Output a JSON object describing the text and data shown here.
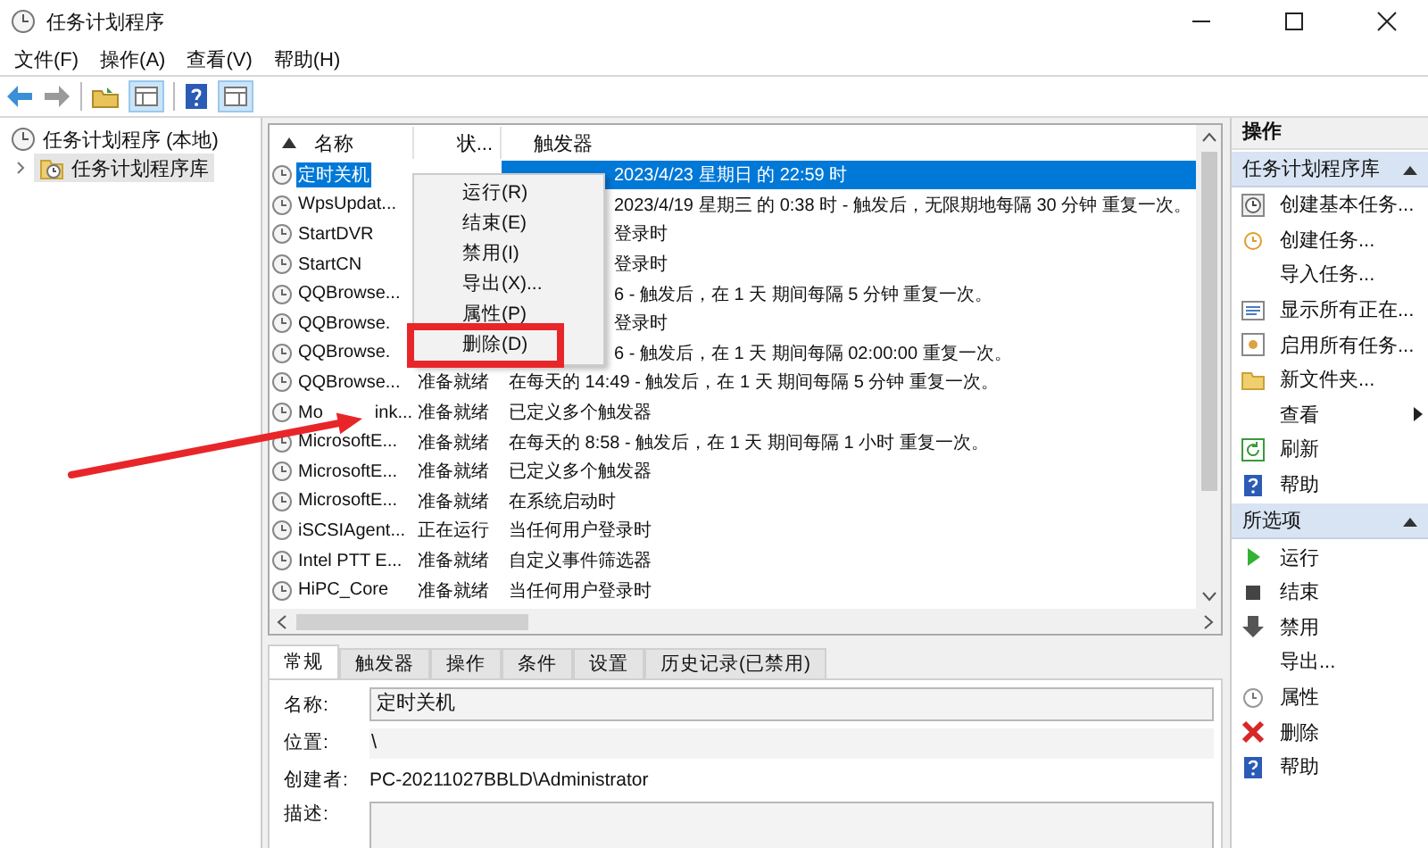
{
  "window": {
    "title": "任务计划程序"
  },
  "menu_bar": [
    "文件(F)",
    "操作(A)",
    "查看(V)",
    "帮助(H)"
  ],
  "tree": [
    {
      "label": "任务计划程序 (本地)",
      "selected": false,
      "children": [
        {
          "label": "任务计划程序库",
          "selected": true,
          "expanded": false
        }
      ]
    }
  ],
  "task_list": {
    "columns": [
      "名称",
      "状...",
      "触发器"
    ],
    "rows": [
      {
        "kind": "covered",
        "name": "定时关机",
        "trigger": "2023/4/23 星期日 的 22:59 时",
        "selected": true
      },
      {
        "kind": "covered",
        "name": "WpsUpdat...",
        "trigger": "2023/4/19 星期三 的 0:38 时 - 触发后，无限期地每隔 30 分钟 重复一次。",
        "selected": false
      },
      {
        "kind": "covered",
        "name": "StartDVR",
        "trigger": "登录时",
        "selected": false
      },
      {
        "kind": "covered",
        "name": "StartCN",
        "trigger": "登录时",
        "selected": false
      },
      {
        "kind": "covered",
        "name": "QQBrowse...",
        "trigger": "6 - 触发后，在 1 天 期间每隔 5 分钟 重复一次。",
        "selected": false
      },
      {
        "kind": "covered",
        "name": "QQBrowse.",
        "trigger": "登录时",
        "selected": false
      },
      {
        "kind": "covered",
        "name": "QQBrowse.",
        "trigger": "6 - 触发后，在 1 天 期间每隔 02:00:00 重复一次。",
        "selected": false
      },
      {
        "kind": "full",
        "name": "QQBrowse...",
        "status": "准备就绪",
        "trigger": "在每天的 14:49 - 触发后，在 1 天 期间每隔 5 分钟 重复一次。",
        "selected": false
      },
      {
        "kind": "split",
        "name": "Mo",
        "name_tail": "ink...",
        "status": "准备就绪",
        "trigger": "已定义多个触发器",
        "selected": false
      },
      {
        "kind": "full",
        "name": "MicrosoftE...",
        "status": "准备就绪",
        "trigger": "在每天的 8:58 - 触发后，在 1 天 期间每隔 1 小时 重复一次。",
        "selected": false
      },
      {
        "kind": "full",
        "name": "MicrosoftE...",
        "status": "准备就绪",
        "trigger": "已定义多个触发器",
        "selected": false
      },
      {
        "kind": "full",
        "name": "MicrosoftE...",
        "status": "准备就绪",
        "trigger": "在系统启动时",
        "selected": false
      },
      {
        "kind": "full",
        "name": "iSCSIAgent...",
        "status": "正在运行",
        "trigger": "当任何用户登录时",
        "selected": false
      },
      {
        "kind": "full",
        "name": "Intel PTT E...",
        "status": "准备就绪",
        "trigger": "自定义事件筛选器",
        "selected": false
      },
      {
        "kind": "full",
        "name": "HiPC_Core",
        "status": "准备就绪",
        "trigger": "当任何用户登录时",
        "selected": false
      }
    ]
  },
  "context_menu": {
    "items": [
      {
        "label": "运行(R)",
        "marked": false
      },
      {
        "label": "结束(E)",
        "marked": false
      },
      {
        "label": "禁用(I)",
        "marked": false
      },
      {
        "label": "导出(X)...",
        "marked": false
      },
      {
        "label": "属性(P)",
        "marked": false
      },
      {
        "label": "删除(D)",
        "marked": true
      }
    ]
  },
  "detail": {
    "tabs": [
      {
        "label": "常规",
        "selected": true
      },
      {
        "label": "触发器",
        "selected": false
      },
      {
        "label": "操作",
        "selected": false
      },
      {
        "label": "条件",
        "selected": false
      },
      {
        "label": "设置",
        "selected": false
      },
      {
        "label": "历史记录(已禁用)",
        "selected": false
      }
    ],
    "fields": [
      {
        "kind": "field",
        "label": "名称:",
        "value": "定时关机"
      },
      {
        "kind": "readonly",
        "label": "位置:",
        "value": "\\"
      },
      {
        "kind": "text",
        "label": "创建者:",
        "value": "PC-20211027BBLD\\Administrator"
      },
      {
        "kind": "area",
        "label": "描述:"
      }
    ]
  },
  "actions_pane": {
    "title": "操作",
    "sections": [
      {
        "title": "任务计划程序库",
        "expanded": true,
        "items": [
          {
            "label": "创建基本任务...",
            "submenu": false
          },
          {
            "label": "创建任务...",
            "submenu": false
          },
          {
            "label": "导入任务...",
            "submenu": false
          },
          {
            "label": "显示所有正在...",
            "submenu": false
          },
          {
            "label": "启用所有任务...",
            "submenu": false
          },
          {
            "label": "新文件夹...",
            "submenu": false
          },
          {
            "label": "查看",
            "submenu": true
          },
          {
            "label": "刷新",
            "submenu": false
          },
          {
            "label": "帮助",
            "submenu": false
          }
        ]
      },
      {
        "title": "所选项",
        "expanded": true,
        "items": [
          {
            "label": "运行",
            "submenu": false
          },
          {
            "label": "结束",
            "submenu": false
          },
          {
            "label": "禁用",
            "submenu": false
          },
          {
            "label": "导出...",
            "submenu": false
          },
          {
            "label": "属性",
            "submenu": false
          },
          {
            "label": "删除",
            "submenu": false
          },
          {
            "label": "帮助",
            "submenu": false
          }
        ]
      }
    ]
  }
}
